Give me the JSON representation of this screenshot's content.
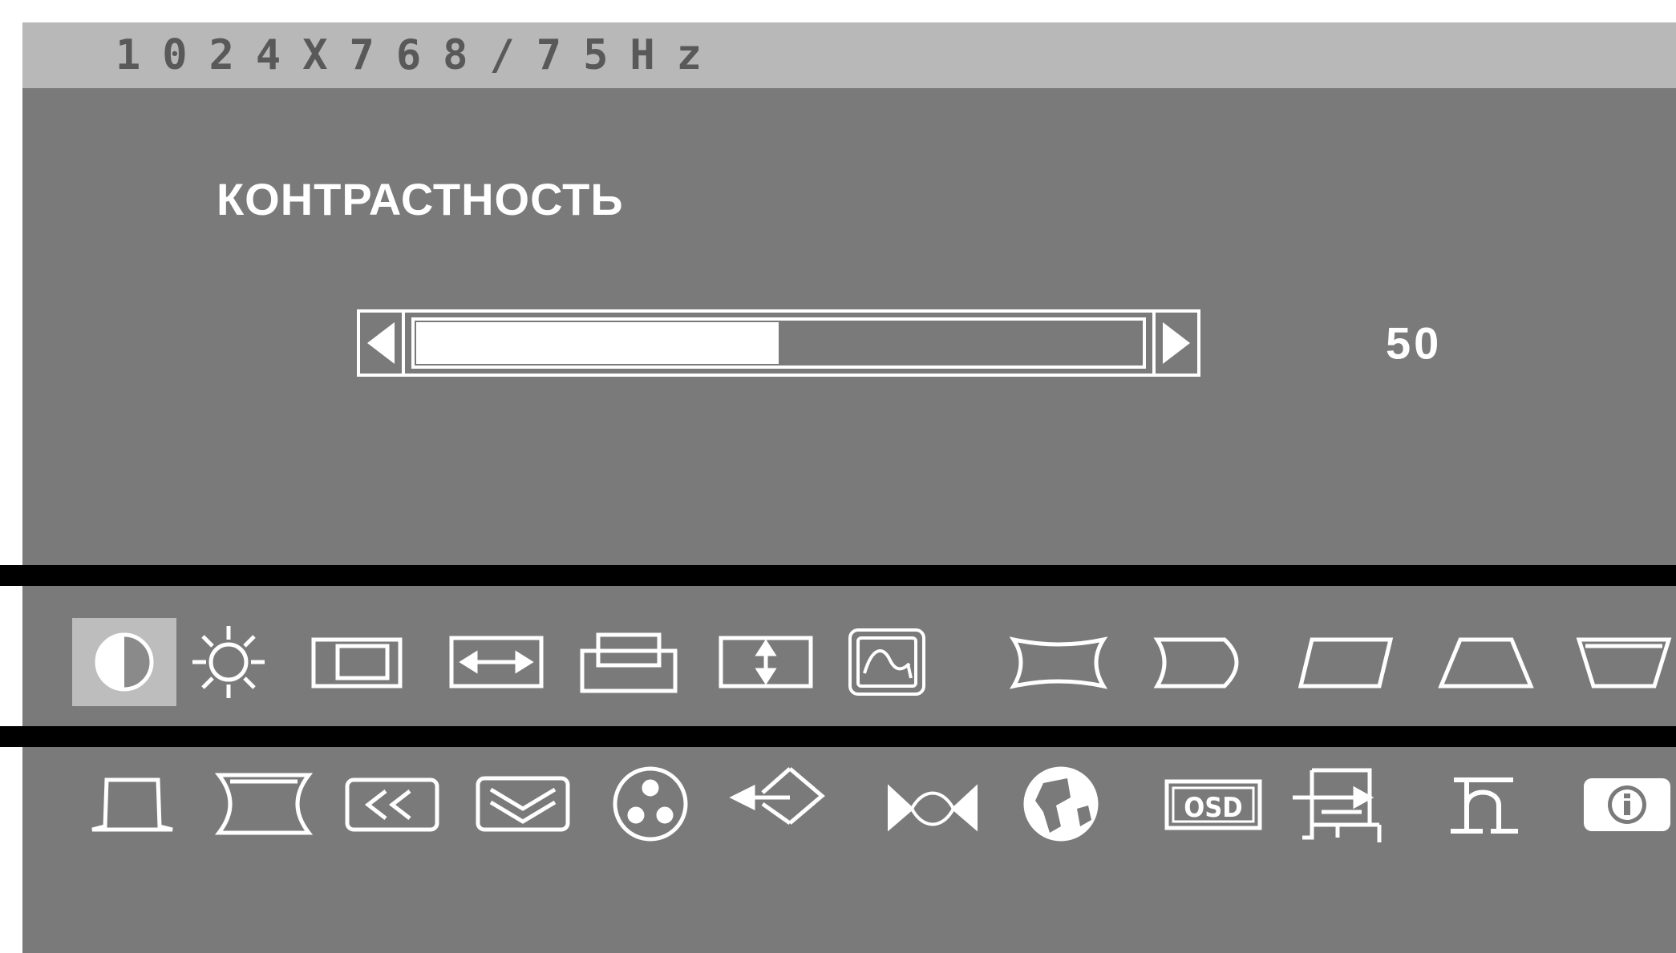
{
  "header": {
    "resolution_text": "1024X768/75Hz"
  },
  "menu": {
    "title": "КОНТРАСТНОСТЬ",
    "value": "50",
    "slider_fraction": 0.5,
    "selected_index": 0
  },
  "icon_rows": [
    [
      "contrast-icon",
      "brightness-icon",
      "horizontal-size-icon",
      "horizontal-position-icon",
      "vertical-size-icon",
      "vertical-position-icon",
      "moire-icon",
      "pincushion-icon",
      "pin-balance-icon",
      "parallelogram-icon",
      "trapezoid-icon",
      "trapezoid-inverted-icon"
    ],
    [
      "key-balance-icon",
      "side-pincushion-icon",
      "horizontal-convergence-icon",
      "vertical-convergence-icon",
      "color-icon",
      "exit-icon",
      "degauss-icon",
      "language-icon",
      "osd-position-icon",
      "input-setup-icon",
      "recall-icon",
      "information-icon"
    ]
  ],
  "labels": {
    "osd_badge": "OSD"
  },
  "colors": {
    "osd_background": "#7a7a7a",
    "title_bar": "#b8b8b8",
    "foreground": "#ffffff",
    "separator": "#000000"
  }
}
